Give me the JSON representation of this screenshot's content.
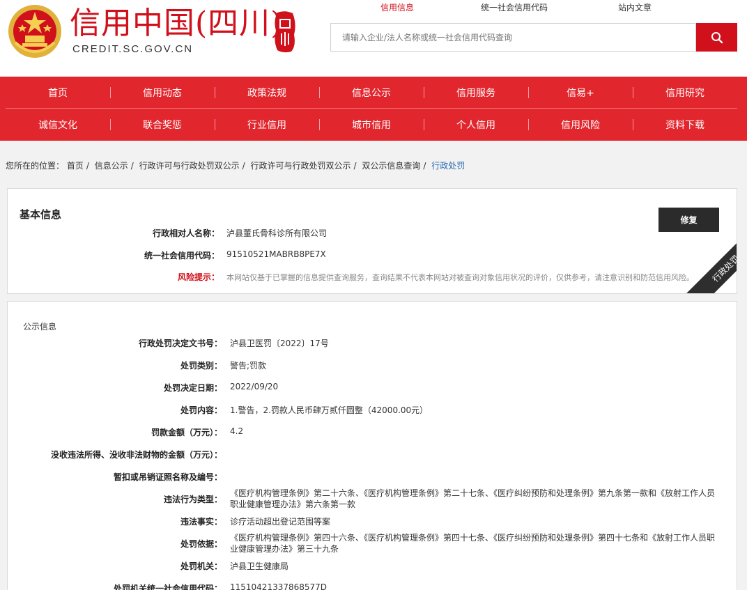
{
  "header": {
    "title": "信用中国(四川)",
    "domain": "CREDIT.SC.GOV.CN",
    "top_links": [
      "信用信息",
      "统一社会信用代码",
      "站内文章"
    ],
    "search_placeholder": "请输入企业/法人名称或统一社会信用代码查询"
  },
  "nav": {
    "row1": [
      "首页",
      "信用动态",
      "政策法规",
      "信息公示",
      "信用服务",
      "信易+",
      "信用研究"
    ],
    "row2": [
      "诚信文化",
      "联合奖惩",
      "行业信用",
      "城市信用",
      "个人信用",
      "信用风险",
      "资料下载"
    ]
  },
  "breadcrumb": {
    "prefix": "您所在的位置：",
    "items": [
      "首页",
      "信息公示",
      "行政许可与行政处罚双公示",
      "行政许可与行政处罚双公示",
      "双公示信息查询"
    ],
    "current": "行政处罚"
  },
  "basic": {
    "title": "基本信息",
    "fix_label": "修复",
    "ribbon": "行政处罚",
    "rows": [
      {
        "label": "行政相对人名称：",
        "value": "泸县董氏骨科诊所有限公司"
      },
      {
        "label": "统一社会信用代码：",
        "value": "91510521MABRB8PE7X"
      }
    ],
    "risk_label": "风险提示：",
    "risk_text": "本网站仅基于已掌握的信息提供查询服务，查询结果不代表本网站对被查询对象信用状况的评价，仅供参考，请注意识别和防范信用风险。"
  },
  "public": {
    "title": "公示信息",
    "rows": [
      {
        "label": "行政处罚决定文书号：",
        "value": "泸县卫医罚〔2022〕17号"
      },
      {
        "label": "处罚类别：",
        "value": "警告;罚款"
      },
      {
        "label": "处罚决定日期：",
        "value": "2022/09/20"
      },
      {
        "label": "处罚内容：",
        "value": "1.警告，2.罚款人民币肆万贰仟圆整（42000.00元）"
      },
      {
        "label": "罚款金额（万元）：",
        "value": "4.2"
      },
      {
        "label": "没收违法所得、没收非法财物的金额（万元）：",
        "value": ""
      },
      {
        "label": "暂扣或吊销证照名称及编号：",
        "value": ""
      },
      {
        "label": "违法行为类型：",
        "value": "《医疗机构管理条例》第二十六条、《医疗机构管理条例》第二十七条、《医疗纠纷预防和处理条例》第九条第一款和《放射工作人员职业健康管理办法》第六条第一款"
      },
      {
        "label": "违法事实：",
        "value": "诊疗活动超出登记范围等案"
      },
      {
        "label": "处罚依据：",
        "value": "《医疗机构管理条例》第四十六条、《医疗机构管理条例》第四十七条、《医疗纠纷预防和处理条例》第四十七条和《放射工作人员职业健康管理办法》第三十九条"
      },
      {
        "label": "处罚机关：",
        "value": "泸县卫生健康局"
      },
      {
        "label": "处罚机关统一社会信用代码：",
        "value": "11510421337868577D"
      }
    ]
  },
  "colors": {
    "brand_red": "#d0101b",
    "nav_red": "#e2262e"
  }
}
